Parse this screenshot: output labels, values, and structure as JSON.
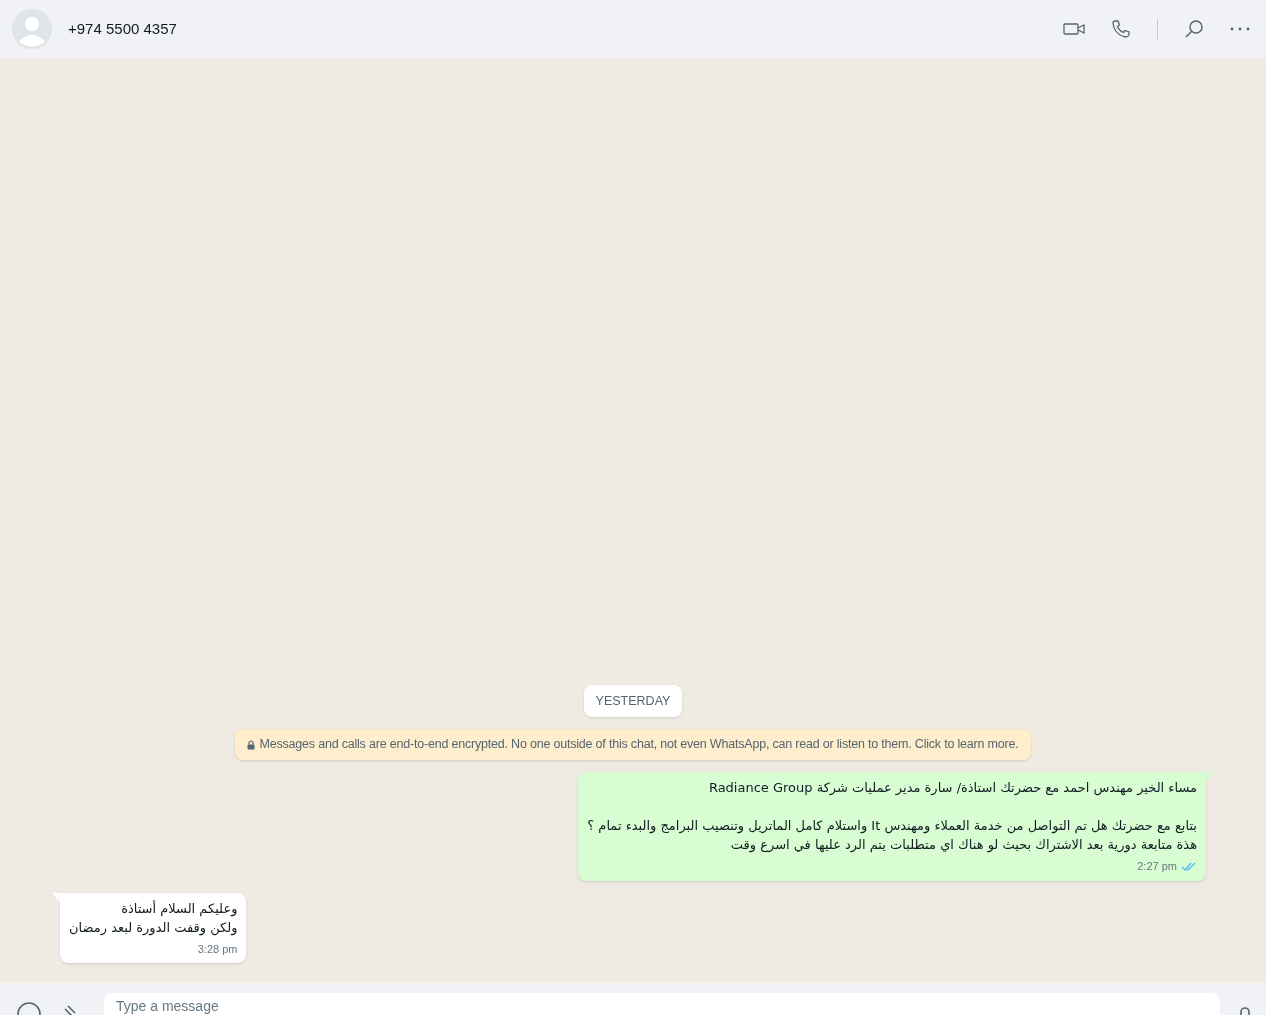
{
  "header": {
    "contact": "+974 5500 4357"
  },
  "date_divider": "YESTERDAY",
  "encryption_notice": "Messages and calls are end-to-end encrypted. No one outside of this chat, not even WhatsApp, can read or listen to them. Click to learn more.",
  "messages": [
    {
      "kind": "outgoing",
      "text": "مساء الخير مهندس احمد مع حضرتك استاذة/ سارة مدير عمليات شركة Radiance Group\n\nبتابع مع حضرتك هل تم التواصل من خدمة العملاء ومهندس It واستلام كامل الماتريل وتنصيب البرامج والبدء تمام ؟\nهذة متابعة دورية بعد الاشتراك بحيث لو هناك اي متطلبات يتم الرد عليها في اسرع وقت",
      "time": "2:27 pm",
      "read": true
    },
    {
      "kind": "incoming",
      "text": "وعليكم السلام أستاذة\nولكن وقفت الدورة لبعد رمضان",
      "time": "3:28 pm"
    }
  ],
  "composer": {
    "placeholder": "Type a message"
  }
}
